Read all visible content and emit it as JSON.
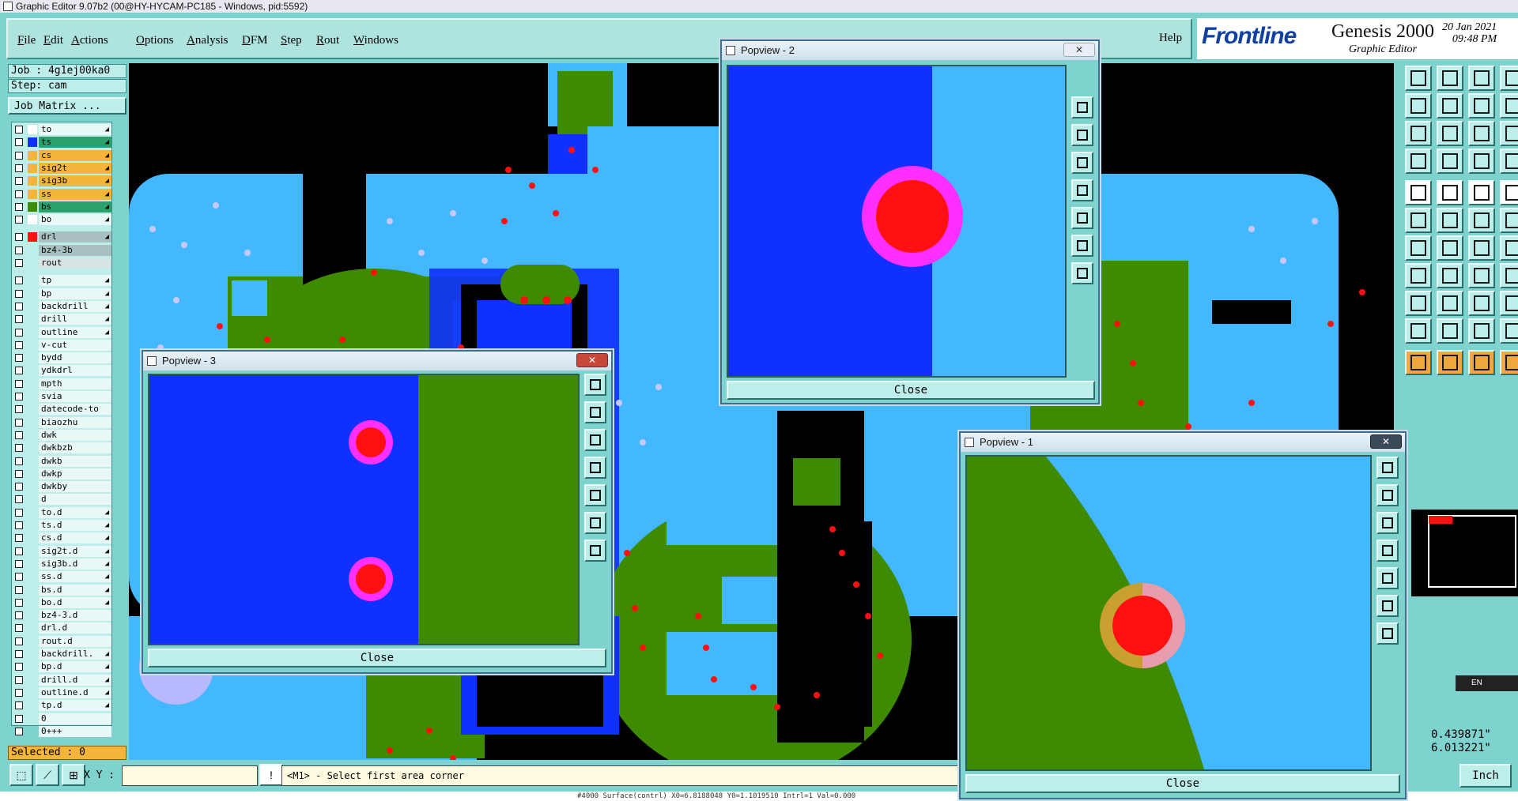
{
  "window": {
    "title": "Graphic Editor 9.07b2 (00@HY-HYCAM-PC185 - Windows, pid:5592)"
  },
  "menu": [
    {
      "label": "File"
    },
    {
      "label": "Edit"
    },
    {
      "label": "Actions"
    },
    {
      "label": "Options"
    },
    {
      "label": "Analysis"
    },
    {
      "label": "DFM"
    },
    {
      "label": "Step"
    },
    {
      "label": "Rout"
    },
    {
      "label": "Windows"
    }
  ],
  "help_label": "Help",
  "brand": {
    "logo": "Frontline",
    "product": "Genesis 2000",
    "subtitle": "Graphic Editor",
    "date": "20 Jan 2021",
    "time": "09:48 PM"
  },
  "job": {
    "job_label": "Job : 4g1ej00ka0",
    "step_label": "Step: cam",
    "matrix_button": "Job Matrix ..."
  },
  "layers": [
    {
      "name": "to",
      "color": "#ffffff",
      "arrow": true
    },
    {
      "name": "ts",
      "color": "#1030ff",
      "arrow": true,
      "highlight": "#2aa06a"
    },
    {
      "name": "cs",
      "color": "#f4b63a",
      "arrow": true,
      "highlight": "#f4b63a"
    },
    {
      "name": "sig2t",
      "color": "#f4b63a",
      "arrow": true,
      "highlight": "#f4b63a"
    },
    {
      "name": "sig3b",
      "color": "#f4b63a",
      "arrow": true,
      "highlight": "#f4b63a"
    },
    {
      "name": "ss",
      "color": "#f4b63a",
      "arrow": true,
      "highlight": "#f4b63a"
    },
    {
      "name": "bs",
      "color": "#3e8a00",
      "arrow": true,
      "highlight": "#2aa06a"
    },
    {
      "name": "bo",
      "color": "#ffffff",
      "arrow": true
    },
    {
      "name": "drl",
      "color": "#ff1010",
      "arrow": true,
      "highlight": "#a8c0c0"
    },
    {
      "name": "bz4-3b",
      "color": "",
      "arrow": false,
      "highlight": "#a8c0c0"
    },
    {
      "name": "rout",
      "color": "",
      "arrow": false,
      "highlight": "#d8e4e4"
    },
    {
      "name": "tp",
      "color": "",
      "arrow": true
    },
    {
      "name": "bp",
      "color": "",
      "arrow": true
    },
    {
      "name": "backdrill",
      "color": "",
      "arrow": true
    },
    {
      "name": "drill",
      "color": "",
      "arrow": true
    },
    {
      "name": "outline",
      "color": "",
      "arrow": true
    },
    {
      "name": "v-cut",
      "color": "",
      "arrow": false
    },
    {
      "name": "bydd",
      "color": "",
      "arrow": false
    },
    {
      "name": "ydkdrl",
      "color": "",
      "arrow": false
    },
    {
      "name": "mpth",
      "color": "",
      "arrow": false
    },
    {
      "name": "svia",
      "color": "",
      "arrow": false
    },
    {
      "name": "datecode-to",
      "color": "",
      "arrow": false
    },
    {
      "name": "biaozhu",
      "color": "",
      "arrow": false
    },
    {
      "name": "dwk",
      "color": "",
      "arrow": false
    },
    {
      "name": "dwkbzb",
      "color": "",
      "arrow": false
    },
    {
      "name": "dwkb",
      "color": "",
      "arrow": false
    },
    {
      "name": "dwkp",
      "color": "",
      "arrow": false
    },
    {
      "name": "dwkby",
      "color": "",
      "arrow": false
    },
    {
      "name": "d",
      "color": "",
      "arrow": false
    },
    {
      "name": "to.d",
      "color": "",
      "arrow": true
    },
    {
      "name": "ts.d",
      "color": "",
      "arrow": true
    },
    {
      "name": "cs.d",
      "color": "",
      "arrow": true
    },
    {
      "name": "sig2t.d",
      "color": "",
      "arrow": true
    },
    {
      "name": "sig3b.d",
      "color": "",
      "arrow": true
    },
    {
      "name": "ss.d",
      "color": "",
      "arrow": true
    },
    {
      "name": "bs.d",
      "color": "",
      "arrow": true
    },
    {
      "name": "bo.d",
      "color": "",
      "arrow": true
    },
    {
      "name": "bz4-3.d",
      "color": "",
      "arrow": false
    },
    {
      "name": "drl.d",
      "color": "",
      "arrow": false
    },
    {
      "name": "rout.d",
      "color": "",
      "arrow": false
    },
    {
      "name": "backdrill.",
      "color": "",
      "arrow": true
    },
    {
      "name": "bp.d",
      "color": "",
      "arrow": true
    },
    {
      "name": "drill.d",
      "color": "",
      "arrow": true
    },
    {
      "name": "outline.d",
      "color": "",
      "arrow": true
    },
    {
      "name": "tp.d",
      "color": "",
      "arrow": true
    },
    {
      "name": "0",
      "color": "",
      "arrow": false
    },
    {
      "name": "0+++",
      "color": "",
      "arrow": false
    }
  ],
  "selected_label": "Selected : 0",
  "popups": [
    {
      "title": "Popview - 2",
      "close_label": "Close"
    },
    {
      "title": "Popview - 3",
      "close_label": "Close"
    },
    {
      "title": "Popview - 1",
      "close_label": "Close"
    }
  ],
  "coords": {
    "x": "0.439871\"",
    "y": "6.013221\""
  },
  "status": {
    "xy_label": "X Y :",
    "prompt": "<M1> - Select first area corner",
    "units": "Inch",
    "footer": "#4000 Surface(contrl) X0=6.8188048 Y0=1.1019510 Intrl=1 Val=0.000"
  },
  "language": "EN",
  "colors": {
    "teal": "#7fd3cf",
    "copper_blue": "#1030ff",
    "light_blue": "#44b8ff",
    "green": "#3e8a00",
    "pad_red": "#ff1010",
    "magenta": "#ff30ff"
  }
}
